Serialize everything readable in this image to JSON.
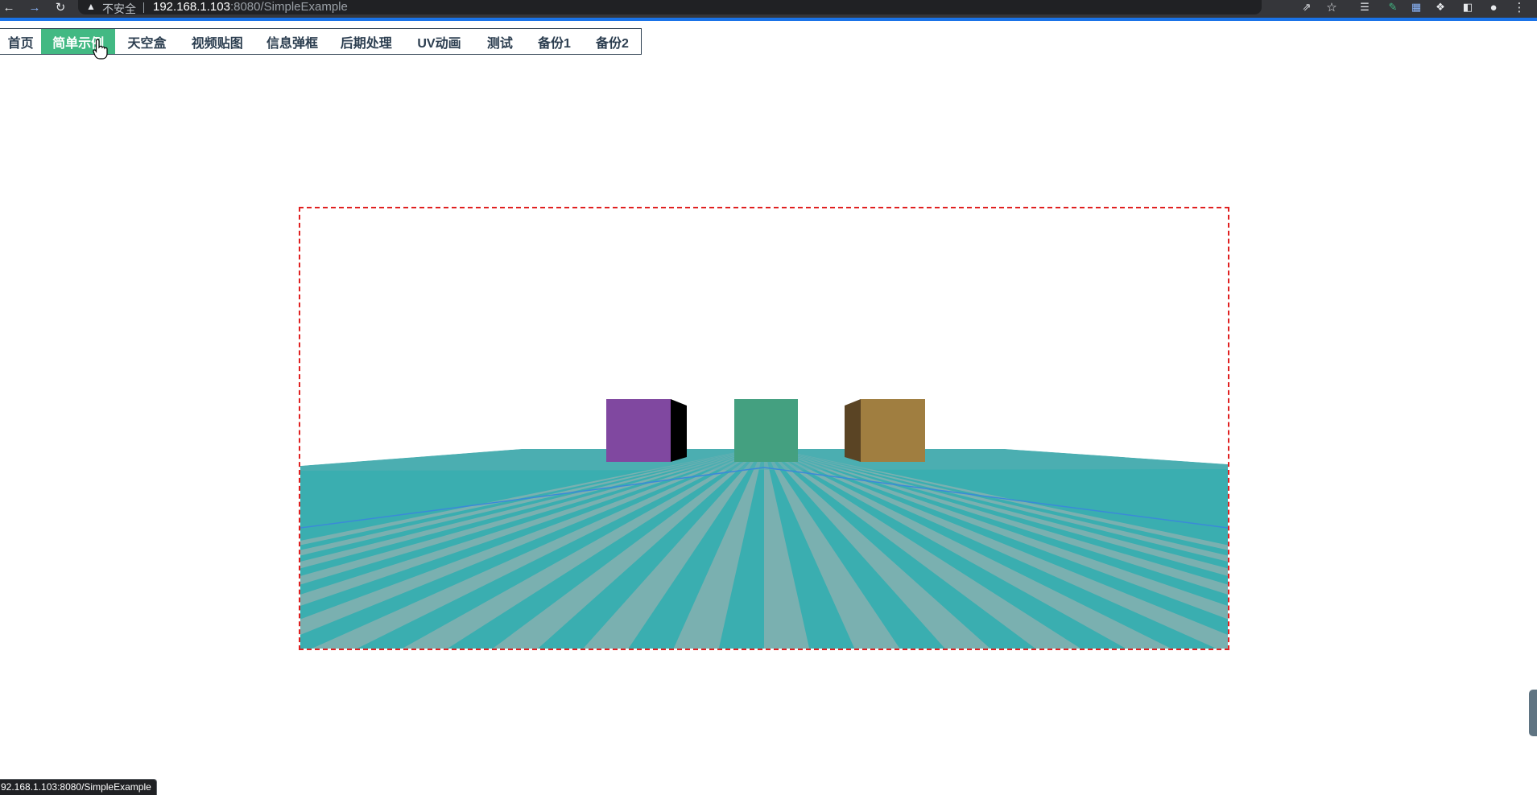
{
  "browser": {
    "insecure_label": "不安全",
    "url_host": "192.168.1.103",
    "url_rest": ":8080/SimpleExample",
    "status_url": "92.168.1.103:8080/SimpleExample"
  },
  "nav": {
    "items": [
      {
        "label": "首页"
      },
      {
        "label": "简单示例",
        "active": true
      },
      {
        "label": "天空盒"
      },
      {
        "label": "视频贴图"
      },
      {
        "label": "信息弹框"
      },
      {
        "label": "后期处理"
      },
      {
        "label": "UV动画"
      },
      {
        "label": "测试"
      },
      {
        "label": "备份1"
      },
      {
        "label": "备份2"
      }
    ]
  },
  "scene": {
    "colors": {
      "stripe_dark": "#3aaeb0",
      "stripe_light": "#7ab0b0",
      "far_plane": "#5aaeb2",
      "axis_line": "#3a8ad8",
      "cube_purple": "#8048a0",
      "cube_green": "#44a080",
      "cube_brown": "#a07e40",
      "frame_border": "#e02020",
      "nav_active": "#42b983"
    },
    "cubes": [
      "purple-cube",
      "green-cube",
      "brown-cube"
    ]
  }
}
